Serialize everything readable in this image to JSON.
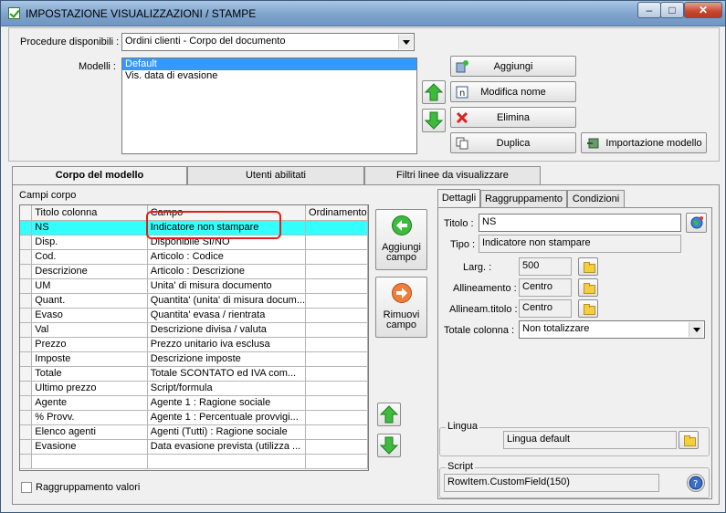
{
  "window": {
    "title": "IMPOSTAZIONE VISUALIZZAZIONI / STAMPE",
    "minimize": "–",
    "maximize": "□",
    "close": "✕"
  },
  "procedure": {
    "label": "Procedure disponibili :",
    "selected": "Ordini clienti - Corpo del documento"
  },
  "modelli": {
    "label": "Modelli :",
    "items": [
      {
        "text": "Default",
        "selected": true
      },
      {
        "text": "Vis. data di evasione",
        "selected": false
      }
    ]
  },
  "buttons": {
    "aggiungi": "Aggiungi",
    "modifica_nome": "Modifica nome",
    "elimina": "Elimina",
    "duplica": "Duplica",
    "importazione": "Importazione modello"
  },
  "tabs": [
    {
      "label": "Corpo del modello",
      "active": true
    },
    {
      "label": "Utenti abilitati",
      "active": false
    },
    {
      "label": "Filtri linee da visualizzare",
      "active": false
    }
  ],
  "campi_corpo": {
    "label": "Campi corpo",
    "headers": [
      "Titolo colonna",
      "Campo",
      "Ordinamento"
    ],
    "rows": [
      [
        "NS",
        "Indicatore non stampare",
        ""
      ],
      [
        "Disp.",
        "Disponibile SI/NO",
        ""
      ],
      [
        "Cod.",
        "Articolo : Codice",
        ""
      ],
      [
        "Descrizione",
        "Articolo : Descrizione",
        ""
      ],
      [
        "UM",
        "Unita' di misura documento",
        ""
      ],
      [
        "Quant.",
        "Quantita' (unita' di misura docum...",
        ""
      ],
      [
        "Evaso",
        "Quantita' evasa / rientrata",
        ""
      ],
      [
        "Val",
        "Descrizione divisa / valuta",
        ""
      ],
      [
        "Prezzo",
        "Prezzo unitario iva esclusa",
        ""
      ],
      [
        "Imposte",
        "Descrizione imposte",
        ""
      ],
      [
        "Totale",
        "Totale SCONTATO ed IVA com...",
        ""
      ],
      [
        "Ultimo prezzo",
        "Script/formula",
        ""
      ],
      [
        "Agente",
        "Agente 1 : Ragione sociale",
        ""
      ],
      [
        "% Provv.",
        "Agente 1 : Percentuale provvigi...",
        ""
      ],
      [
        "Elenco agenti",
        "Agenti (Tutti) : Ragione sociale",
        ""
      ],
      [
        "Evasione",
        "Data evasione prevista (utilizza ...",
        ""
      ],
      [
        "",
        "",
        ""
      ]
    ]
  },
  "side_buttons": {
    "aggiungi_campo": "Aggiungi campo",
    "rimuovi_campo": "Rimuovi campo"
  },
  "raggruppamento_valori": "Raggruppamento valori",
  "detail_tabs": [
    {
      "label": "Dettagli",
      "active": true
    },
    {
      "label": "Raggruppamento",
      "active": false
    },
    {
      "label": "Condizioni",
      "active": false
    }
  ],
  "dettagli": {
    "titolo_label": "Titolo :",
    "titolo_value": "NS",
    "tipo_label": "Tipo :",
    "tipo_value": "Indicatore non stampare",
    "larg_label": "Larg. :",
    "larg_value": "500",
    "allineamento_label": "Allineamento :",
    "allineamento_value": "Centro",
    "allineam_titolo_label": "Allineam.titolo :",
    "allineam_titolo_value": "Centro",
    "totale_label": "Totale colonna :",
    "totale_value": "Non totalizzare"
  },
  "lingua": {
    "label": "Lingua",
    "value": "Lingua default"
  },
  "script": {
    "label": "Script",
    "value": "RowItem.CustomField(150)"
  }
}
